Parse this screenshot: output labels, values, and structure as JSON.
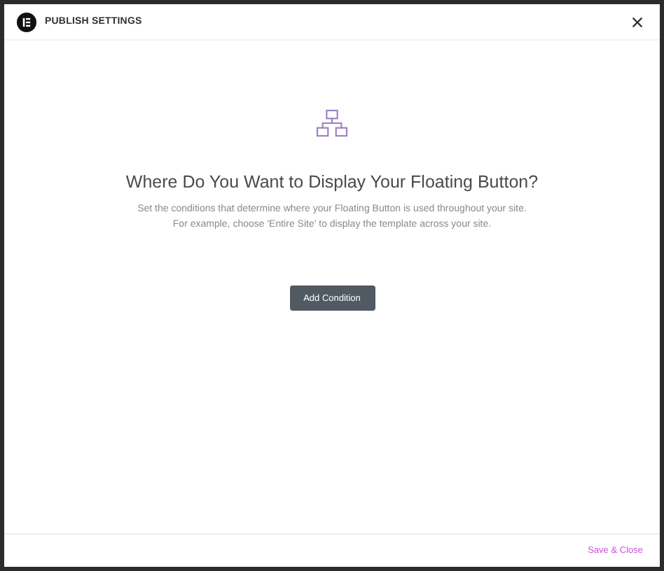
{
  "window": {
    "title": "PUBLISH SETTINGS"
  },
  "content": {
    "heading": "Where Do You Want to Display Your Floating Button?",
    "description": [
      "Set the conditions that determine where your Floating Button is used throughout your site.",
      "For example, choose 'Entire Site' to display the template across your site."
    ],
    "button": "Add Condition"
  },
  "footer": {
    "button": "Save & Close"
  }
}
